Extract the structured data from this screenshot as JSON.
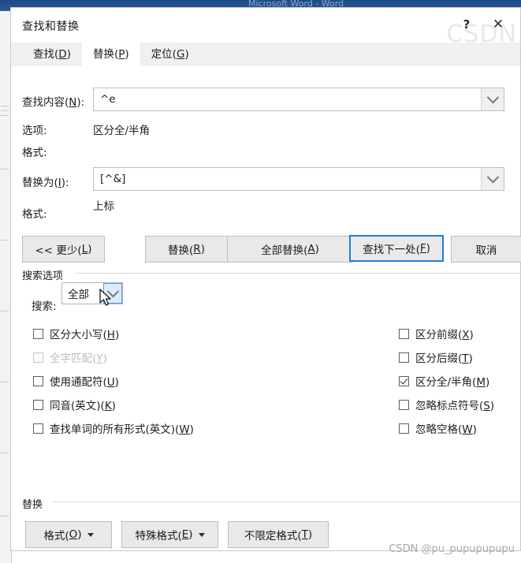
{
  "background": {
    "ghost_title": "Microsoft Word  -  Word",
    "ghost_mark": "CSDN"
  },
  "dialog": {
    "title": "查找和替换",
    "help_label": "?",
    "close_label": "✕"
  },
  "tabs": [
    {
      "label": "查找(",
      "accel": "D",
      "suffix": ")",
      "active": false,
      "name": "tab-find"
    },
    {
      "label": "替换(",
      "accel": "P",
      "suffix": ")",
      "active": true,
      "name": "tab-replace"
    },
    {
      "label": "定位(",
      "accel": "G",
      "suffix": ")",
      "active": false,
      "name": "tab-goto"
    }
  ],
  "form": {
    "find_label": "查找内容(",
    "find_accel": "N",
    "find_label_suffix": "):",
    "find_value": "^e",
    "options_label": "选项:",
    "options_value": "区分全/半角",
    "find_format_label": "格式:",
    "find_format_value": "",
    "replace_label": "替换为(",
    "replace_accel": "I",
    "replace_label_suffix": "):",
    "replace_value": "[^&]",
    "replace_format_label": "格式:",
    "replace_format_value": "上标"
  },
  "buttons": {
    "less": {
      "text": "<< 更少(",
      "accel": "L",
      "suffix": ")"
    },
    "replace": {
      "text": "替换(",
      "accel": "R",
      "suffix": ")"
    },
    "replace_all": {
      "text": "全部替换(",
      "accel": "A",
      "suffix": ")"
    },
    "find_next": {
      "text": "查找下一处(",
      "accel": "F",
      "suffix": ")",
      "focused": true
    },
    "cancel": {
      "text": "取消",
      "accel": "",
      "suffix": ""
    }
  },
  "search_options": {
    "group_title": "搜索选项",
    "search_label": "搜索:",
    "search_value": "全部",
    "left_checkboxes": [
      {
        "label": "区分大小写(",
        "accel": "H",
        "suffix": ")",
        "checked": false,
        "disabled": false,
        "name": "checkbox-match-case"
      },
      {
        "label": "全字匹配(",
        "accel": "Y",
        "suffix": ")",
        "checked": false,
        "disabled": true,
        "name": "checkbox-whole-word"
      },
      {
        "label": "使用通配符(",
        "accel": "U",
        "suffix": ")",
        "checked": false,
        "disabled": false,
        "name": "checkbox-wildcards"
      },
      {
        "label": "同音(英文)(",
        "accel": "K",
        "suffix": ")",
        "checked": false,
        "disabled": false,
        "name": "checkbox-sounds-like"
      },
      {
        "label": "查找单词的所有形式(英文)(",
        "accel": "W",
        "suffix": ")",
        "checked": false,
        "disabled": false,
        "name": "checkbox-all-word-forms"
      }
    ],
    "right_checkboxes": [
      {
        "label": "区分前缀(",
        "accel": "X",
        "suffix": ")",
        "checked": false,
        "disabled": false,
        "name": "checkbox-match-prefix"
      },
      {
        "label": "区分后缀(",
        "accel": "T",
        "suffix": ")",
        "checked": false,
        "disabled": false,
        "name": "checkbox-match-suffix"
      },
      {
        "label": "区分全/半角(",
        "accel": "M",
        "suffix": ")",
        "checked": true,
        "disabled": false,
        "name": "checkbox-match-halfwidth"
      },
      {
        "label": "忽略标点符号(",
        "accel": "S",
        "suffix": ")",
        "checked": false,
        "disabled": false,
        "name": "checkbox-ignore-punctuation"
      },
      {
        "label": "忽略空格(",
        "accel": "W",
        "suffix": ")",
        "checked": false,
        "disabled": false,
        "name": "checkbox-ignore-whitespace"
      }
    ]
  },
  "replace_section": {
    "group_title": "替换",
    "format": {
      "text": "格式(",
      "accel": "O",
      "suffix": ")",
      "caret": true
    },
    "special": {
      "text": "特殊格式(",
      "accel": "E",
      "suffix": ")",
      "caret": true
    },
    "no_formatting": {
      "text": "不限定格式(",
      "accel": "T",
      "suffix": ")",
      "caret": false
    }
  },
  "watermark": "CSDN @pu_pupupupupu"
}
